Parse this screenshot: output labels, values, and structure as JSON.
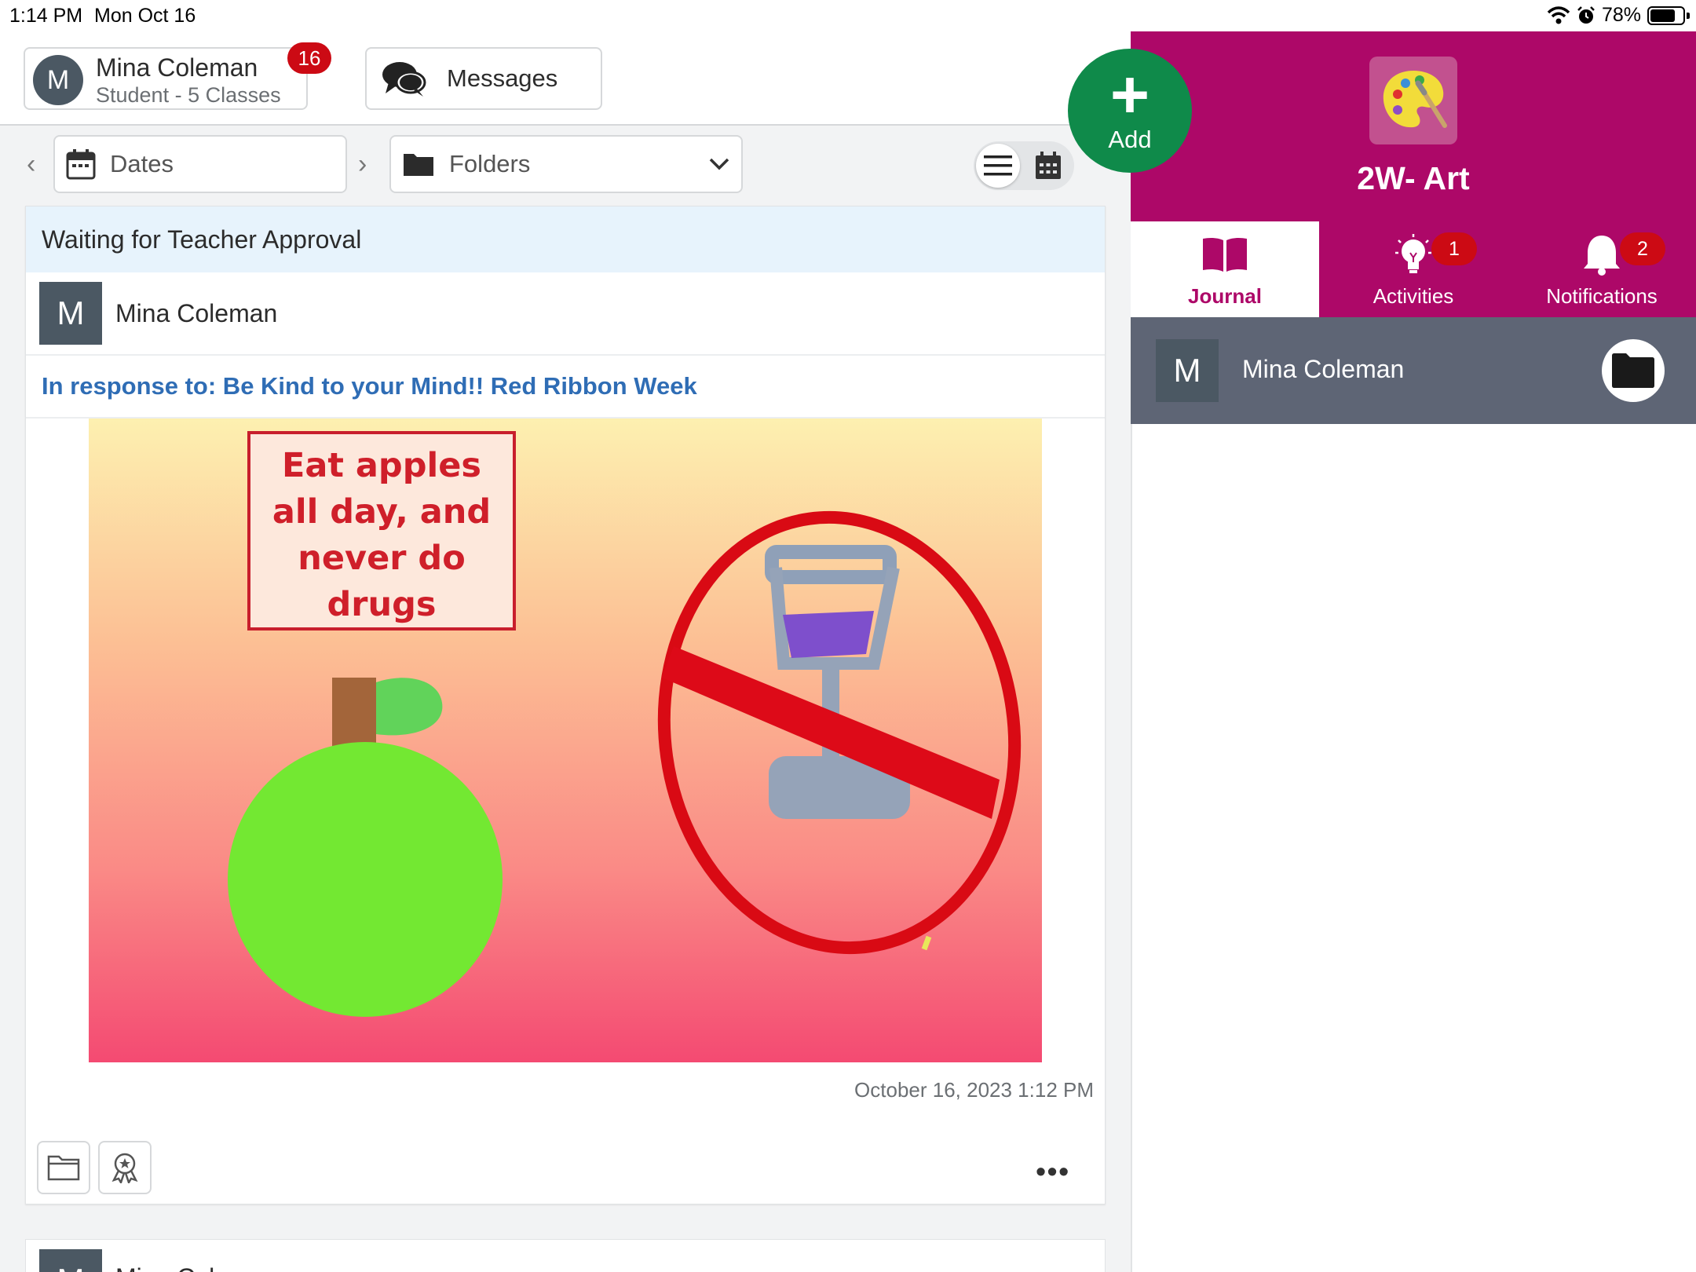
{
  "status_bar": {
    "time": "1:14 PM",
    "date": "Mon Oct 16",
    "battery": "78%",
    "battery_level": 0.78,
    "icons": [
      "wifi-icon",
      "alarm-icon",
      "battery-icon"
    ]
  },
  "user": {
    "initial": "M",
    "name": "Mina Coleman",
    "subtitle": "Student - 5 Classes",
    "badge": "16"
  },
  "messages": {
    "label": "Messages",
    "icon": "chat-bubbles-icon"
  },
  "toolbar": {
    "dates_label": "Dates",
    "folders_label": "Folders"
  },
  "add_button": {
    "label": "Add"
  },
  "post": {
    "status": "Waiting for Teacher Approval",
    "author_initial": "M",
    "author": "Mina Coleman",
    "response": "In response to: Be Kind to your Mind!! Red Ribbon Week",
    "artwork_text": [
      "Eat apples",
      "all day, and",
      "never do",
      "drugs"
    ],
    "timestamp": "October 16, 2023 1:12 PM",
    "more": "•••"
  },
  "next_post": {
    "author_initial": "M",
    "author": "Mina Coleman"
  },
  "class_panel": {
    "title": "2W- Art",
    "icon": "art-palette-icon",
    "colors": {
      "brand": "#ad0868",
      "add_green": "#0f8a4a",
      "badge_red": "#cc0a14",
      "link_blue": "#2f6db5"
    },
    "tabs": [
      {
        "label": "Journal",
        "icon": "book-icon",
        "badge": ""
      },
      {
        "label": "Activities",
        "icon": "lightbulb-icon",
        "badge": "1"
      },
      {
        "label": "Notifications",
        "icon": "bell-icon",
        "badge": "2"
      }
    ],
    "student": {
      "initial": "M",
      "name": "Mina Coleman"
    }
  }
}
